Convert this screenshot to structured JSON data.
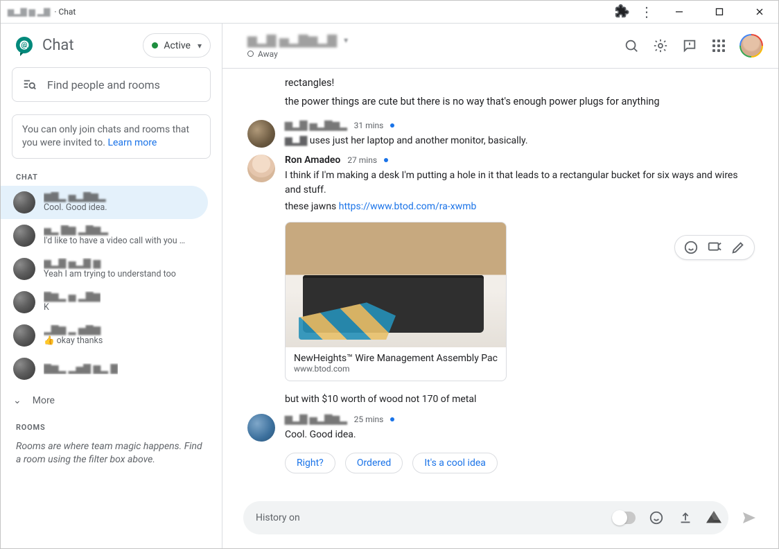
{
  "window": {
    "title_suffix": " · Chat"
  },
  "sidebar": {
    "app_name": "Chat",
    "status_label": "Active",
    "search_placeholder": "Find people and rooms",
    "invite_notice_pre": "You can only join chats and rooms that you were invited to. ",
    "learn_more": "Learn more",
    "section_chat": "CHAT",
    "items": [
      {
        "preview": "Cool. Good idea.",
        "selected": true
      },
      {
        "preview": "I'd like to have a video call with you on …",
        "selected": false
      },
      {
        "preview": "Yeah I am trying to understand too",
        "selected": false
      },
      {
        "preview": "K",
        "selected": false
      },
      {
        "preview": "👍 okay thanks",
        "selected": false
      },
      {
        "preview": "",
        "selected": false
      }
    ],
    "more_label": "More",
    "section_rooms": "ROOMS",
    "rooms_info": "Rooms are where team magic happens. Find a room using the filter box above."
  },
  "header": {
    "status_text": "Away"
  },
  "conversation": {
    "pre_lines": [
      "rectangles!",
      "the power things are cute but there is no way that's enough power plugs for anything"
    ],
    "msg1": {
      "time": "31 mins",
      "text_suffix": " uses just her laptop and another monitor, basically."
    },
    "msg2": {
      "author": "Ron Amadeo",
      "time": "27 mins",
      "line1": "I think if I'm making a desk I'm putting a hole in it that leads to a rectangular bucket for six ways and wires and stuff.",
      "line2_pre": "these jawns ",
      "link_text": "https://www.btod.com/ra-xwmb",
      "card_title": "NewHeights™ Wire Management Assembly Pack",
      "card_domain": "www.btod.com",
      "line3": "but with $10 worth of wood not 170 of metal"
    },
    "msg3": {
      "time": "25 mins",
      "text": "Cool. Good idea."
    },
    "suggestions": [
      "Right?",
      "Ordered",
      "It's a cool idea"
    ],
    "composer_placeholder": "History on"
  }
}
